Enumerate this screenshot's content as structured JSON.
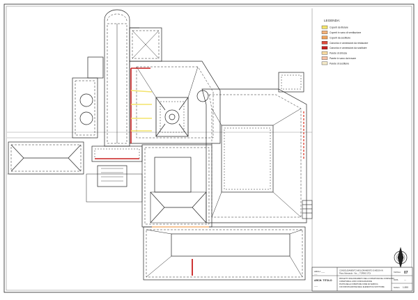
{
  "legend": {
    "title": "LEGENDA:",
    "items": [
      {
        "label": "Coperti da titolare",
        "color": "#f3e36a"
      },
      {
        "label": "Coperti in vano di ventilazione",
        "color": "#f5b27a"
      },
      {
        "label": "Coperti da sostituire",
        "color": "#f0a35c"
      },
      {
        "label": "Canonico e annessioni da restaurare",
        "color": "#e04b3b"
      },
      {
        "label": "Canonico e annessioni da sostituire",
        "color": "#c81e1e"
      },
      {
        "label": "Parete di striscia",
        "color": "#f7d9a0"
      },
      {
        "label": "Parete in vano da trovare",
        "color": "#f9c2a6"
      },
      {
        "label": "Parete di sostituire",
        "color": "#f4e9c8"
      }
    ]
  },
  "titleblock": {
    "firm_line1": "ARCH. ___",
    "firm_line2": "___",
    "project_line1": "CONSOLIDAMENTO MIGLIORAMENTO E MESSA IN",
    "project_line2": "Piano Mansarda - Via __ TORINO (TO)",
    "desc_line1": "PROGETTO MIGLIORAMENTO DELLA COPERTURA DEL COMPLESSO",
    "desc_line2": "COPERTURE E LORO CONFIGURAZIONE",
    "desc_line3": "PIANTA DELLE COPERTURE COME DA VERIFICA",
    "desc_line4": "CON INDIVIDUAZIONE DEGLI ELEMENTI DA SOSTITUIRE",
    "label_tavola": "TAVOLA",
    "tavola_value": "07",
    "label_data": "DATA",
    "data_value": "---",
    "label_scala": "SCALA",
    "scala_value": "1:200",
    "left_code": "ARCH. TITOLO",
    "left_sub": "___"
  }
}
